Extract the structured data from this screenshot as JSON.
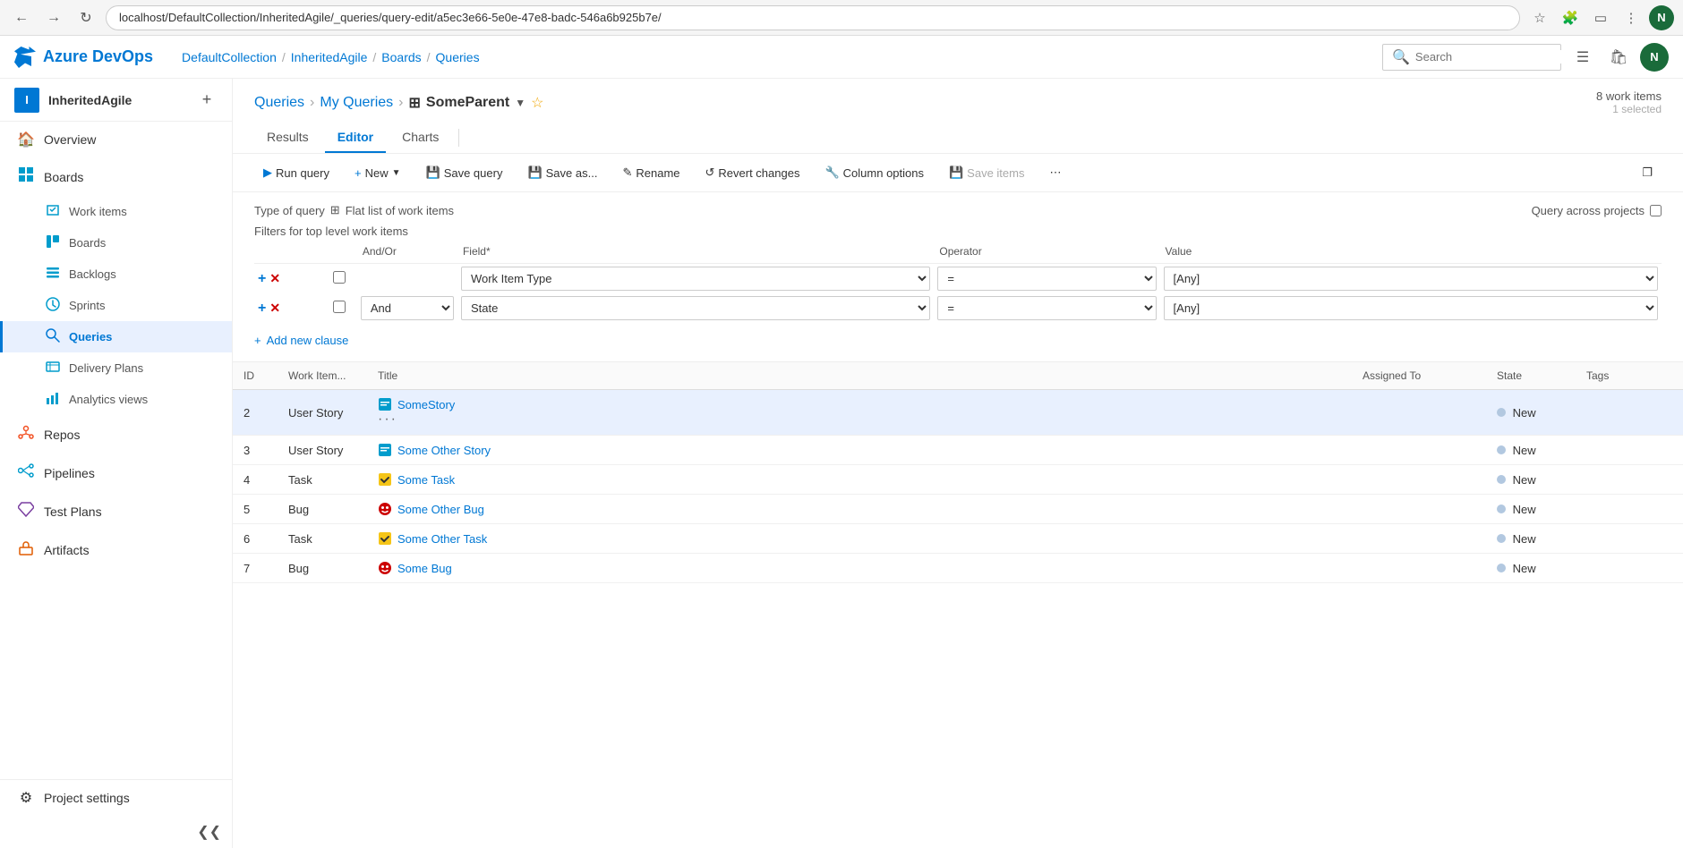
{
  "browser": {
    "url": "localhost/DefaultCollection/InheritedAgile/_queries/query-edit/a5ec3e66-5e0e-47e8-badc-546a6b925b7e/",
    "avatar_initial": "N"
  },
  "topbar": {
    "logo_text": "Azure DevOps",
    "breadcrumb": [
      "DefaultCollection",
      "/",
      "InheritedAgile",
      "/",
      "Boards",
      "/",
      "Queries"
    ],
    "search_placeholder": "Search",
    "avatar_initial": "N"
  },
  "sidebar": {
    "project_name": "InheritedAgile",
    "nav_items": [
      {
        "id": "overview",
        "label": "Overview",
        "icon": "🏠"
      },
      {
        "id": "boards",
        "label": "Boards",
        "icon": "📋"
      },
      {
        "id": "work-items",
        "label": "Work items",
        "icon": "✅"
      },
      {
        "id": "boards-sub",
        "label": "Boards",
        "icon": "⬛"
      },
      {
        "id": "backlogs",
        "label": "Backlogs",
        "icon": "📄"
      },
      {
        "id": "sprints",
        "label": "Sprints",
        "icon": "🔄"
      },
      {
        "id": "queries",
        "label": "Queries",
        "icon": "🔍",
        "active": true
      },
      {
        "id": "delivery-plans",
        "label": "Delivery Plans",
        "icon": "📅"
      },
      {
        "id": "analytics-views",
        "label": "Analytics views",
        "icon": "📊"
      },
      {
        "id": "repos",
        "label": "Repos",
        "icon": "📂"
      },
      {
        "id": "pipelines",
        "label": "Pipelines",
        "icon": "⚙"
      },
      {
        "id": "test-plans",
        "label": "Test Plans",
        "icon": "🧪"
      },
      {
        "id": "artifacts",
        "label": "Artifacts",
        "icon": "📦"
      }
    ],
    "project_settings": "Project settings",
    "collapse_label": "Collapse"
  },
  "page": {
    "breadcrumb_queries": "Queries",
    "breadcrumb_my_queries": "My Queries",
    "breadcrumb_current": "SomeParent",
    "work_items_count": "8 work items",
    "selected_count": "1 selected"
  },
  "tabs": {
    "items": [
      "Results",
      "Editor",
      "Charts"
    ],
    "active": "Editor"
  },
  "toolbar": {
    "run_query": "Run query",
    "new": "New",
    "save_query": "Save query",
    "save_as": "Save as...",
    "rename": "Rename",
    "revert_changes": "Revert changes",
    "column_options": "Column options",
    "save_items": "Save items",
    "more": "..."
  },
  "query_editor": {
    "type_of_query_label": "Type of query",
    "query_type": "Flat list of work items",
    "query_across_label": "Query across projects",
    "filters_label": "Filters for top level work items",
    "columns": {
      "andor": "And/Or",
      "field": "Field*",
      "operator": "Operator",
      "value": "Value"
    },
    "rows": [
      {
        "andor": "",
        "field": "Work Item Type",
        "operator": "=",
        "value": "[Any]"
      },
      {
        "andor": "And",
        "field": "State",
        "operator": "=",
        "value": "[Any]"
      }
    ],
    "add_clause_label": "Add new clause"
  },
  "results": {
    "columns": [
      "ID",
      "Work Item...",
      "Title",
      "Assigned To",
      "State",
      "Tags"
    ],
    "rows": [
      {
        "id": "2",
        "type": "User Story",
        "type_icon": "story",
        "title": "SomeStory",
        "assigned_to": "",
        "state": "New",
        "tags": "",
        "selected": true,
        "has_actions": true
      },
      {
        "id": "3",
        "type": "User Story",
        "type_icon": "story",
        "title": "Some Other Story",
        "assigned_to": "",
        "state": "New",
        "tags": "",
        "selected": false,
        "has_actions": false
      },
      {
        "id": "4",
        "type": "Task",
        "type_icon": "task",
        "title": "Some Task",
        "assigned_to": "",
        "state": "New",
        "tags": "",
        "selected": false,
        "has_actions": false
      },
      {
        "id": "5",
        "type": "Bug",
        "type_icon": "bug",
        "title": "Some Other Bug",
        "assigned_to": "",
        "state": "New",
        "tags": "",
        "selected": false,
        "has_actions": false
      },
      {
        "id": "6",
        "type": "Task",
        "type_icon": "task",
        "title": "Some Other Task",
        "assigned_to": "",
        "state": "New",
        "tags": "",
        "selected": false,
        "has_actions": false
      },
      {
        "id": "7",
        "type": "Bug",
        "type_icon": "bug",
        "title": "Some Bug",
        "assigned_to": "",
        "state": "New",
        "tags": "",
        "selected": false,
        "has_actions": false
      }
    ]
  },
  "colors": {
    "accent": "#0078d4",
    "brand": "#0078d4",
    "sidebar_active_bg": "#e8f0fe",
    "state_new": "#b2c8e0",
    "story_blue": "#0078d4",
    "task_yellow": "#f5a623",
    "bug_red": "#cc0000"
  }
}
